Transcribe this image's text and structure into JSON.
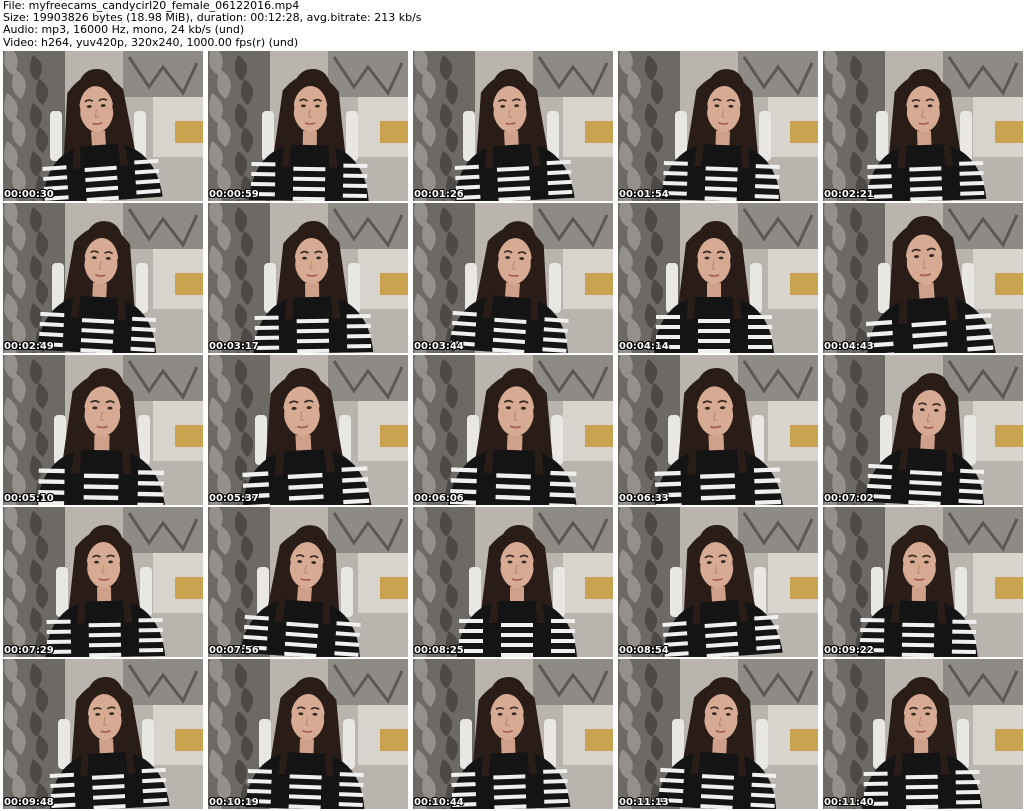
{
  "info": {
    "file": "File: myfreecams_candycirl20_female_06122016.mp4",
    "size": "Size: 19903826 bytes (18.98 MiB), duration: 00:12:28, avg.bitrate: 213 kb/s",
    "audio": "Audio: mp3, 16000 Hz, mono, 24 kb/s (und)",
    "video": "Video: h264, yuv420p, 320x240, 1000.00 fps(r) (und)"
  },
  "thumbnails": [
    {
      "timestamp": "00:00:30"
    },
    {
      "timestamp": "00:00:59"
    },
    {
      "timestamp": "00:01:26"
    },
    {
      "timestamp": "00:01:54"
    },
    {
      "timestamp": "00:02:21"
    },
    {
      "timestamp": "00:02:49"
    },
    {
      "timestamp": "00:03:17"
    },
    {
      "timestamp": "00:03:44"
    },
    {
      "timestamp": "00:04:14"
    },
    {
      "timestamp": "00:04:43"
    },
    {
      "timestamp": "00:05:10"
    },
    {
      "timestamp": "00:05:37"
    },
    {
      "timestamp": "00:06:06"
    },
    {
      "timestamp": "00:06:33"
    },
    {
      "timestamp": "00:07:02"
    },
    {
      "timestamp": "00:07:29"
    },
    {
      "timestamp": "00:07:56"
    },
    {
      "timestamp": "00:08:25"
    },
    {
      "timestamp": "00:08:54"
    },
    {
      "timestamp": "00:09:22"
    },
    {
      "timestamp": "00:09:48"
    },
    {
      "timestamp": "00:10:19"
    },
    {
      "timestamp": "00:10:44"
    },
    {
      "timestamp": "00:11:13"
    },
    {
      "timestamp": "00:11:40"
    }
  ]
}
